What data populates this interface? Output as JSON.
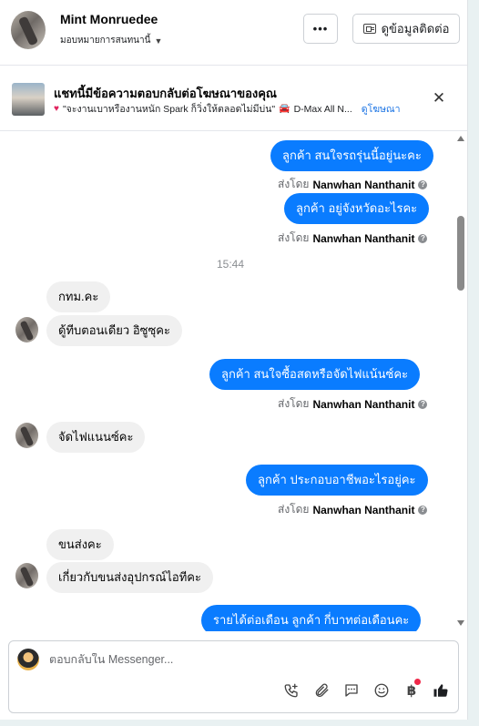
{
  "header": {
    "contact_name": "Mint Monruedee",
    "assign_label": "มอบหมายการสนทนานี้",
    "more_label": "•••",
    "contact_info_label": "ดูข้อมูลติดต่อ"
  },
  "ad_banner": {
    "title": "แชทนี้มีข้อความตอบกลับต่อโฆษณาของคุณ",
    "quote": "\"จะงานเบาหรืองานหนัก Spark ก็วิ่งให้ตลอดไม่มีบ่น\"",
    "product": "D-Max All N...",
    "ad_link": "ดูโฆษณา",
    "close_label": "✕"
  },
  "messages": {
    "m1": "ลูกค้า  สนใจรถรุ่นนี้อยู่นะคะ",
    "m2": "ลูกค้า  อยู่จังหวัดอะไรคะ",
    "time1": "15:44",
    "m3": "กทม.คะ",
    "m4": "ดู้ทีบตอนเดียว อิซูซุคะ",
    "m5": "ลูกค้า  สนใจซื้อสดหรือจัดไฟแน้นซ์คะ",
    "m6": "จัดไฟแนนซ์คะ",
    "m7": "ลูกค้า  ประกอบอาชีพอะไรอยู่คะ",
    "m8": "ขนส่งคะ",
    "m9": "เกี่ยวกับขนส่งอุปกรณ์ไอทีคะ",
    "m10": "รายได้ต่อเดือน ลูกค้า  กี่บาทต่อเดือนคะ"
  },
  "sent_by": {
    "prefix": "ส่งโดย",
    "name": "Nanwhan Nanthanit"
  },
  "composer": {
    "placeholder": "ตอบกลับใน Messenger..."
  },
  "icons": {
    "call": "phone-plus-icon",
    "attach": "paperclip-icon",
    "saved_replies": "chat-bubble-icon",
    "emoji": "smiley-icon",
    "payment": "baht-icon",
    "like": "thumbs-up-icon"
  },
  "colors": {
    "outgoing_bubble": "#0a7cff",
    "incoming_bubble": "#f0f0f0",
    "link": "#1b74e4",
    "notification_dot": "#f02849"
  }
}
